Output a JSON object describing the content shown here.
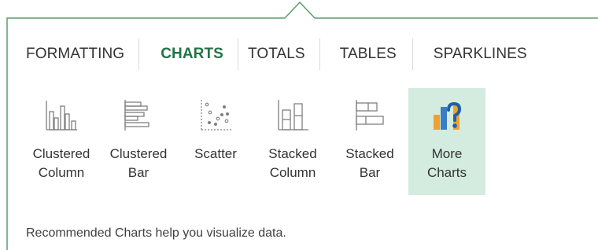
{
  "tabs": [
    {
      "label": "FORMATTING",
      "active": false
    },
    {
      "label": "CHARTS",
      "active": true
    },
    {
      "label": "TOTALS",
      "active": false
    },
    {
      "label": "TABLES",
      "active": false
    },
    {
      "label": "SPARKLINES",
      "active": false
    }
  ],
  "charts": [
    {
      "line1": "Clustered",
      "line2": "Column",
      "icon": "clustered-column-icon"
    },
    {
      "line1": "Clustered",
      "line2": "Bar",
      "icon": "clustered-bar-icon"
    },
    {
      "line1": "Scatter",
      "line2": "",
      "icon": "scatter-icon"
    },
    {
      "line1": "Stacked",
      "line2": "Column",
      "icon": "stacked-column-icon"
    },
    {
      "line1": "Stacked",
      "line2": "Bar",
      "icon": "stacked-bar-icon"
    },
    {
      "line1": "More",
      "line2": "Charts",
      "icon": "more-charts-icon",
      "selected": true
    }
  ],
  "hint": "Recommended Charts help you visualize data.",
  "colors": {
    "accent": "#217346",
    "selected_bg": "#d3ecdf",
    "border": "#5a9e6f"
  }
}
